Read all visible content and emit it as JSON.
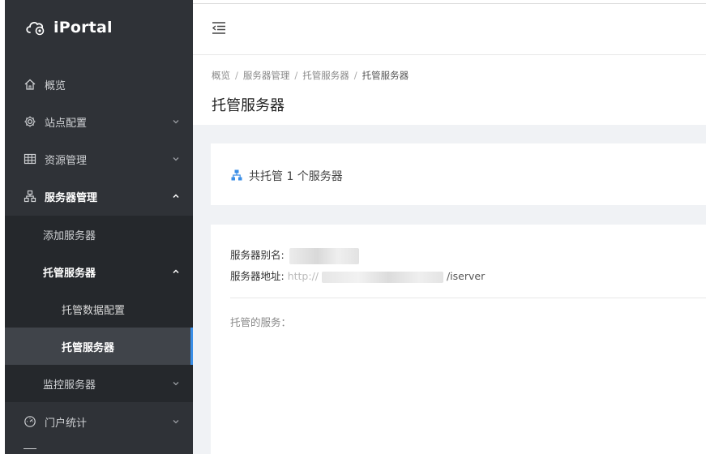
{
  "app": {
    "name": "iPortal"
  },
  "sidebar": {
    "items": [
      {
        "label": "概览",
        "icon": "home-icon"
      },
      {
        "label": "站点配置",
        "icon": "gear-icon"
      },
      {
        "label": "资源管理",
        "icon": "grid-icon"
      },
      {
        "label": "服务器管理",
        "icon": "server-icon"
      },
      {
        "label": "门户统计",
        "icon": "gauge-icon"
      }
    ],
    "server_submenu": {
      "add": "添加服务器",
      "hosted": "托管服务器",
      "hosted_children": {
        "data_config": "托管数据配置",
        "hosted_servers": "托管服务器"
      },
      "monitor": "监控服务器"
    }
  },
  "breadcrumb": [
    "概览",
    "服务器管理",
    "托管服务器",
    "托管服务器"
  ],
  "page_title": "托管服务器",
  "summary": {
    "text": "共托管 1 个服务器"
  },
  "server": {
    "alias_label": "服务器别名:",
    "address_label": "服务器地址:",
    "address_visible_prefix": "http://",
    "address_visible_suffix": "/iserver"
  },
  "services_label": "托管的服务：",
  "colors": {
    "sidebar_bg": "#2f3237",
    "accent": "#3a8ee6",
    "page_bg": "#f0f2f5"
  }
}
